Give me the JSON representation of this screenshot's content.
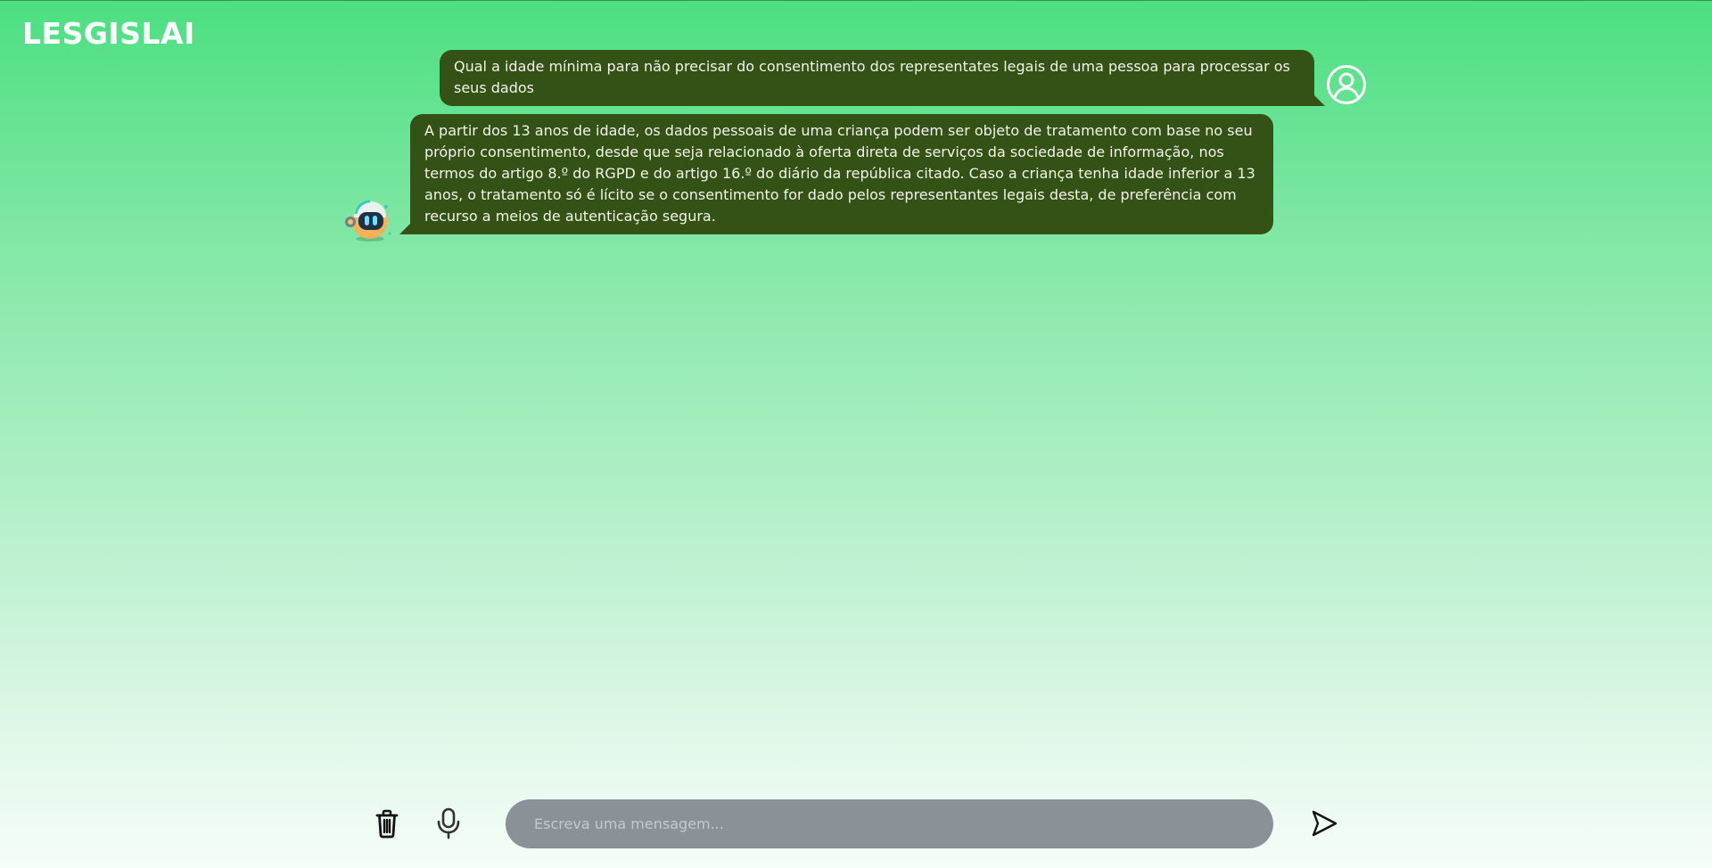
{
  "app": {
    "brand": "LESGISLAI"
  },
  "conversation": {
    "messages": [
      {
        "role": "user",
        "text": "Qual a idade mínima para não precisar do consentimento dos representates legais de uma pessoa para processar os seus dados"
      },
      {
        "role": "assistant",
        "text": "A partir dos 13 anos de idade, os dados pessoais de uma criança podem ser objeto de tratamento com base no seu próprio consentimento, desde que seja relacionado à oferta direta de serviços da sociedade de informação, nos termos do artigo 8.º do RGPD e do artigo 16.º do diário da república citado. Caso a criança tenha idade inferior a 13 anos, o tratamento só é lícito se o consentimento for dado pelos representantes legais desta, de preferência com recurso a meios de autenticação segura."
      }
    ]
  },
  "composer": {
    "placeholder": "Escreva uma mensagem...",
    "value": ""
  },
  "icons": {
    "user_avatar": "user-circle-icon",
    "bot_avatar": "robot-avatar-icon",
    "trash": "trash-icon",
    "mic": "microphone-icon",
    "send": "send-icon"
  },
  "colors": {
    "bubble": "#345215",
    "gradient_top": "#4cdf81",
    "gradient_bottom": "#f5fdf8",
    "input_bg": "#8a9298"
  }
}
